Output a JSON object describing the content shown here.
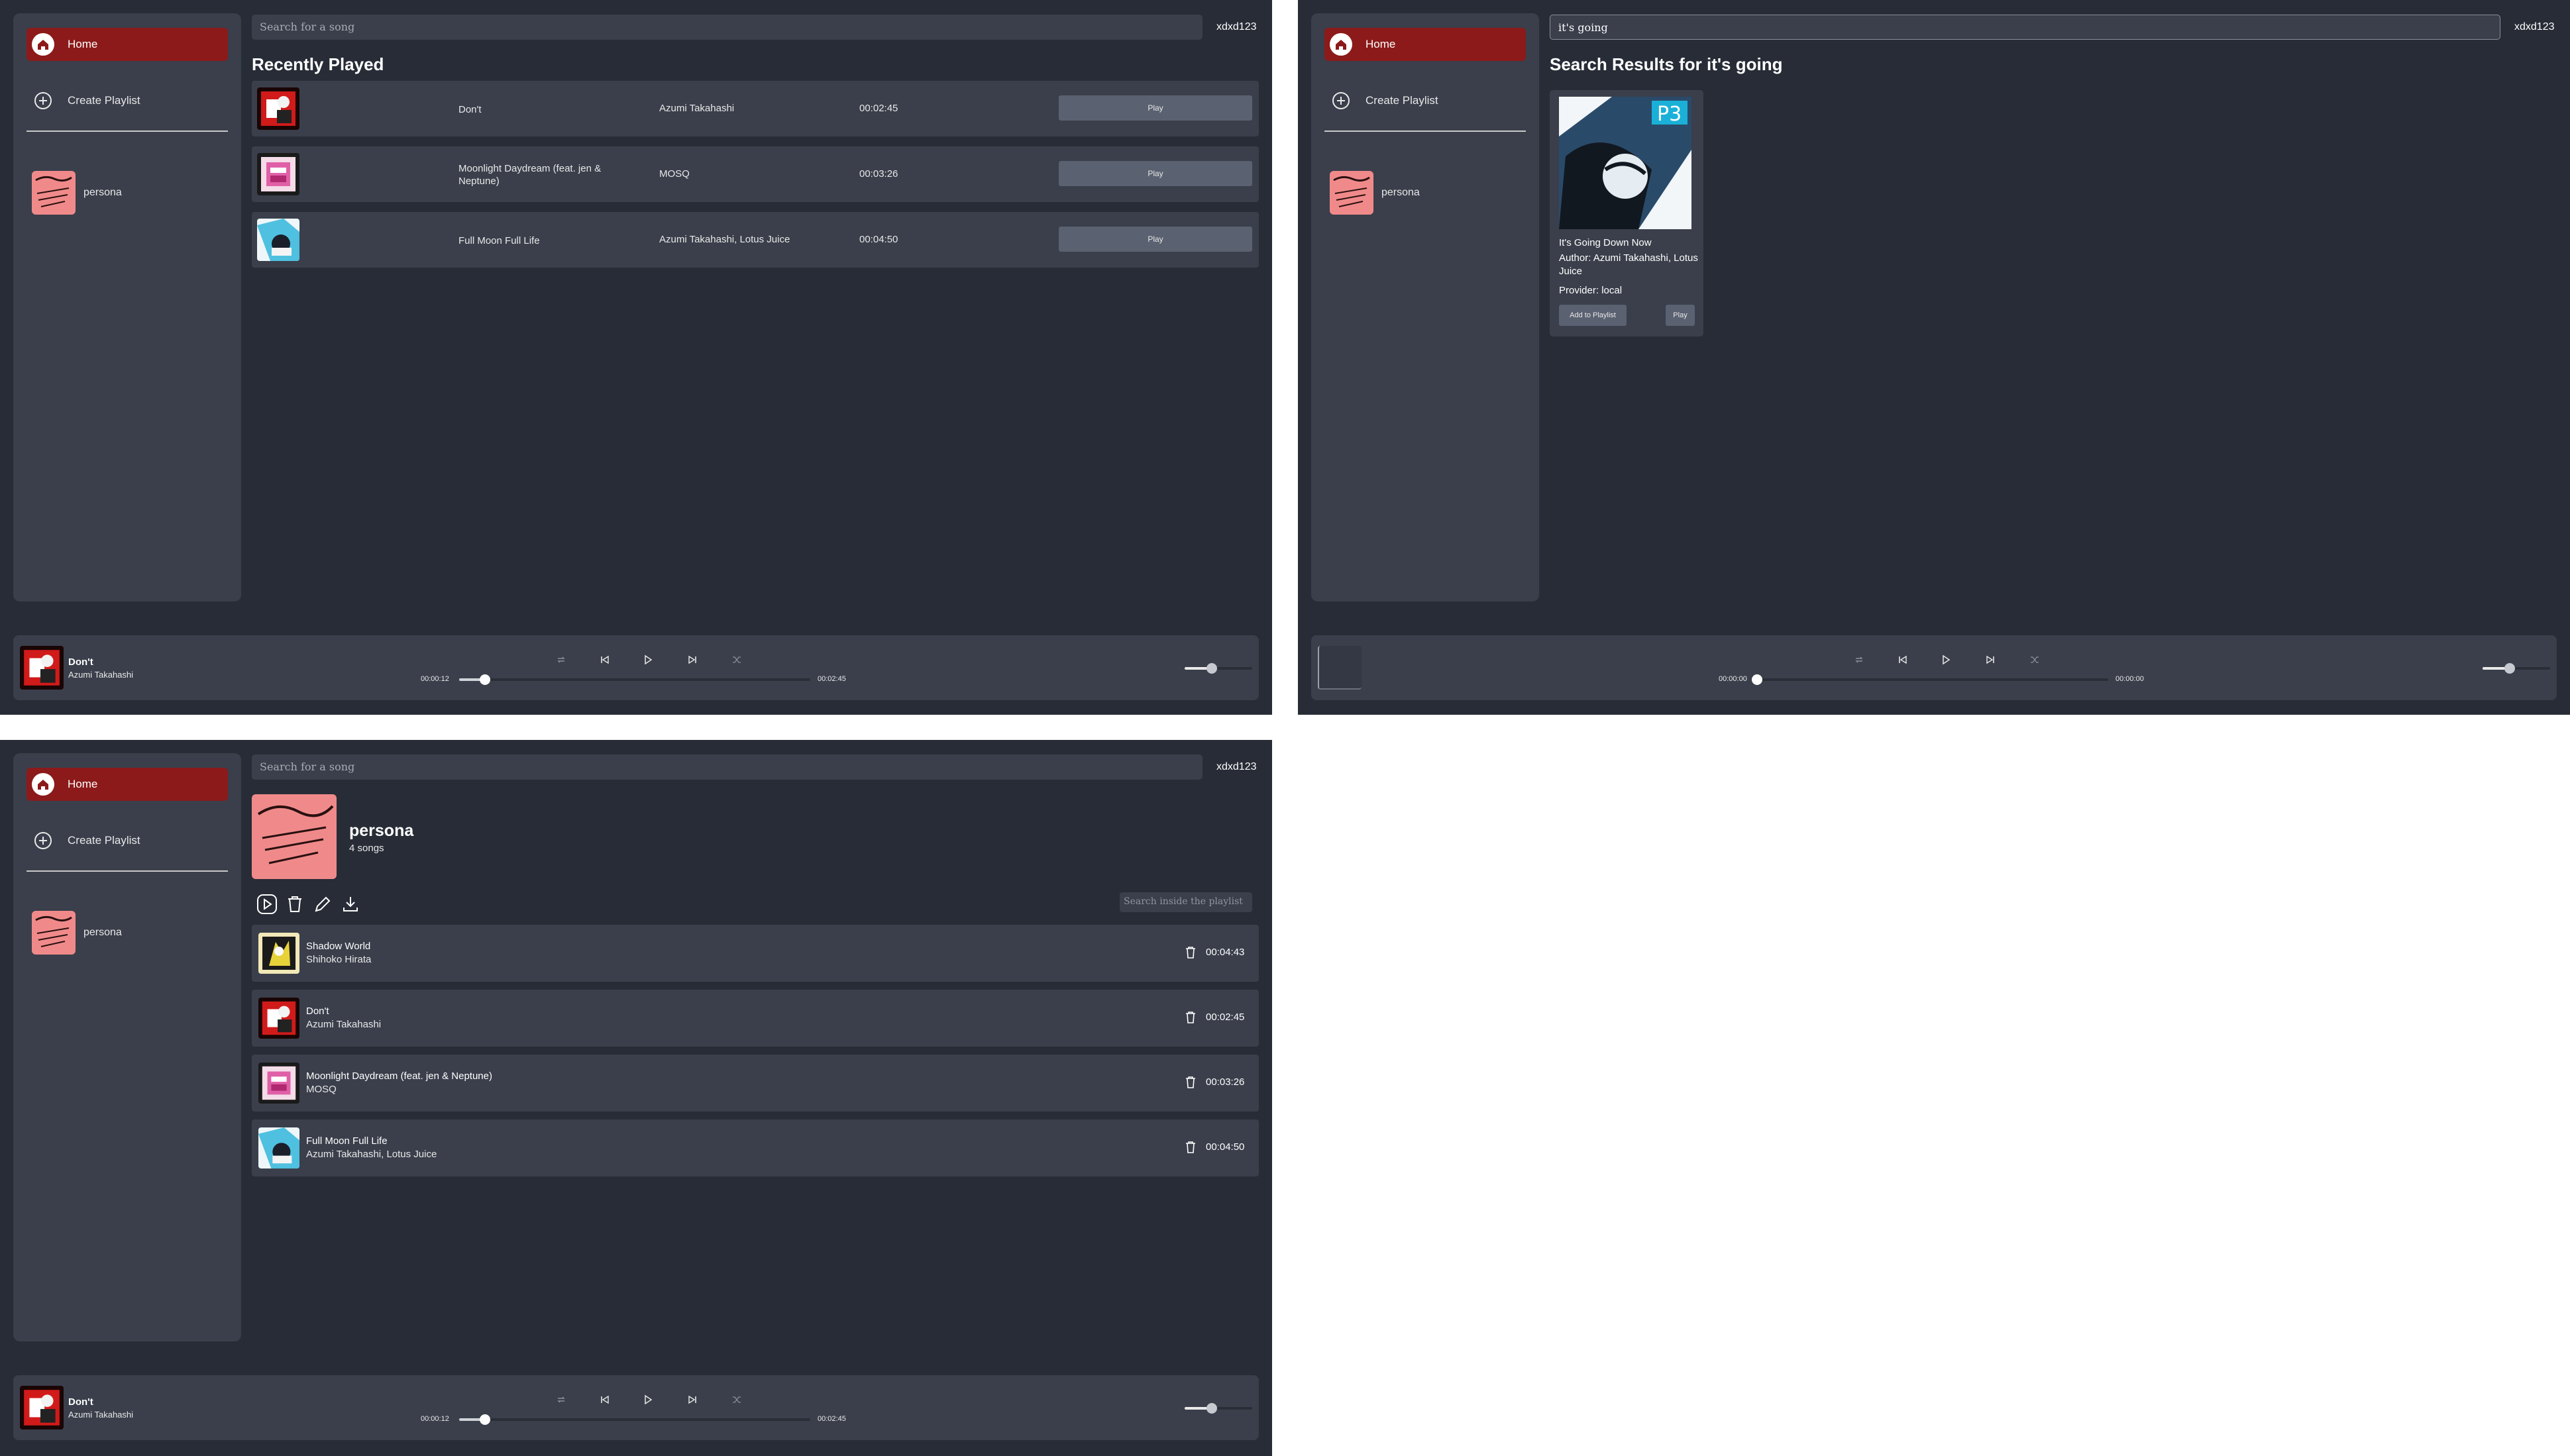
{
  "app": {
    "user": "xdxd123",
    "nav": {
      "home": "Home",
      "create_playlist": "Create Playlist"
    },
    "sidebar_playlists": [
      {
        "name": "persona"
      }
    ]
  },
  "home": {
    "search_placeholder": "Search for a song",
    "heading": "Recently Played",
    "recent": [
      {
        "title": "Don't",
        "artist": "Azumi Takahashi",
        "duration": "00:02:45",
        "play": "Play"
      },
      {
        "title": "Moonlight Daydream (feat. jen & Neptune)",
        "artist": "MOSQ",
        "duration": "00:03:26",
        "play": "Play"
      },
      {
        "title": "Full Moon Full Life",
        "artist": "Azumi Takahashi, Lotus Juice",
        "duration": "00:04:50",
        "play": "Play"
      }
    ]
  },
  "player_main": {
    "title": "Don't",
    "artist": "Azumi Takahashi",
    "elapsed": "00:00:12",
    "total": "00:02:45",
    "progress_fraction": 0.073,
    "volume_fraction": 0.4
  },
  "search_view": {
    "query": "it's going",
    "heading": "Search Results for it's going",
    "result": {
      "title": "It's Going Down Now",
      "author": "Author: Azumi Takahashi, Lotus Juice",
      "provider": "Provider: local",
      "add": "Add to Playlist",
      "play": "Play",
      "cover_text": "P3"
    },
    "player": {
      "elapsed": "00:00:00",
      "total": "00:00:00",
      "progress_fraction": 0,
      "volume_fraction": 0.4
    }
  },
  "playlist_view": {
    "name": "persona",
    "count": "4 songs",
    "search_placeholder": "Search inside the playlist",
    "tracks": [
      {
        "title": "Shadow World",
        "artist": "Shihoko Hirata",
        "duration": "00:04:43"
      },
      {
        "title": "Don't",
        "artist": "Azumi Takahashi",
        "duration": "00:02:45"
      },
      {
        "title": "Moonlight Daydream (feat. jen & Neptune)",
        "artist": "MOSQ",
        "duration": "00:03:26"
      },
      {
        "title": "Full Moon Full Life",
        "artist": "Azumi Takahashi, Lotus Juice",
        "duration": "00:04:50"
      }
    ]
  },
  "colors": {
    "background": "#272c36",
    "panel": "#3a3f4b",
    "accent_red": "#8c1a1a",
    "button": "#5a6170"
  },
  "icons": {
    "home": "home-icon",
    "create": "plus-circle-icon",
    "repeat": "repeat-icon",
    "prev": "skip-back-icon",
    "play": "play-icon",
    "next": "skip-forward-icon",
    "shuffle": "shuffle-icon",
    "trash": "trash-icon",
    "edit": "pencil-icon",
    "download": "download-icon"
  }
}
